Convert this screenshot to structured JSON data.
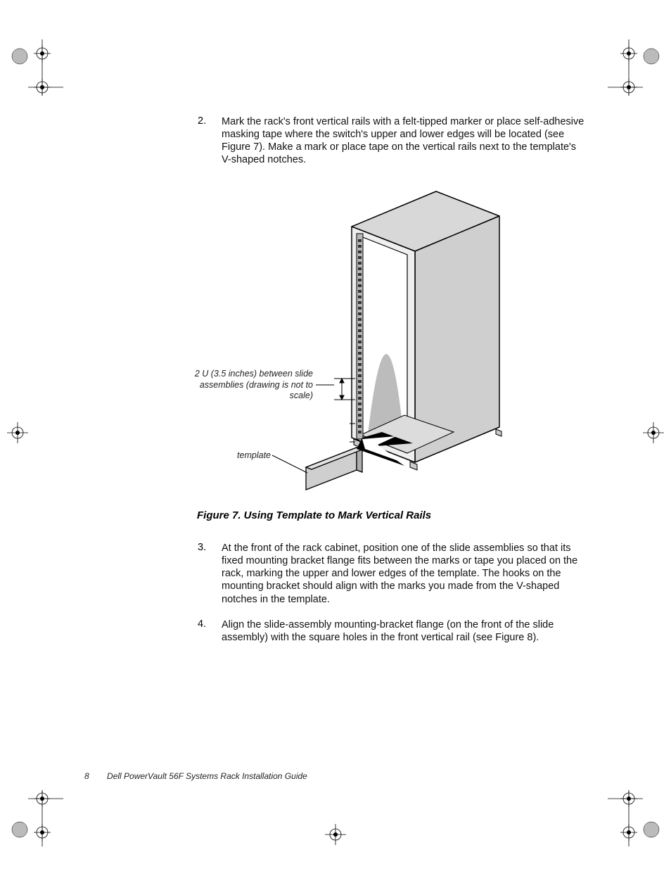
{
  "steps_top": [
    {
      "num": "2.",
      "text": "Mark the rack's front vertical rails with a felt-tipped marker or place self-adhesive masking tape where the switch's upper and lower edges will be located (see Figure 7). Make a mark or place tape on the vertical rails next to the template's V-shaped notches."
    }
  ],
  "figure": {
    "caption": "Figure 7.  Using Template to Mark Vertical Rails",
    "label_measure": "2 U (3.5 inches) between slide assemblies (drawing is not to scale)",
    "label_template": "template"
  },
  "steps_bottom": [
    {
      "num": "3.",
      "text": "At the front of the rack cabinet, position one of the slide assemblies so that its fixed mounting bracket flange fits between the marks or tape you placed on the rack, marking the upper and lower edges of the template. The hooks on the mounting bracket should align with the marks you made from the V-shaped notches in the template."
    },
    {
      "num": "4.",
      "text": "Align the slide-assembly mounting-bracket flange (on the front of the slide assembly) with the square holes in the front vertical rail (see Figure 8)."
    }
  ],
  "footer": {
    "page": "8",
    "title": "Dell PowerVault 56F Systems Rack Installation Guide"
  }
}
